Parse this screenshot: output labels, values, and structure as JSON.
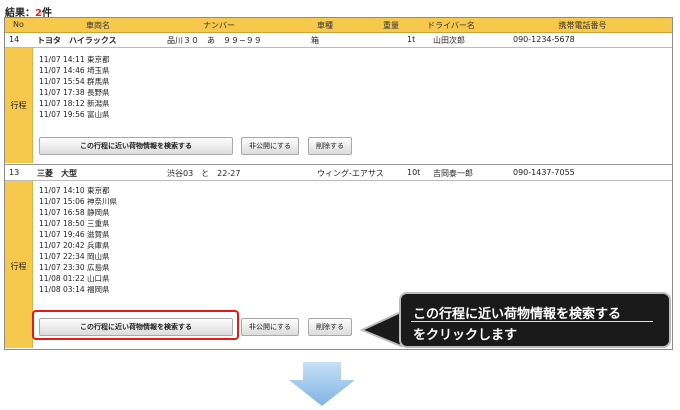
{
  "result": {
    "label": "結果：",
    "count": "2",
    "unit": "件"
  },
  "table": {
    "headers": [
      "No",
      "車両名",
      "ナンバー",
      "車種",
      "重量",
      "ドライバー名",
      "携帯電話番号"
    ],
    "trip_label": "行程"
  },
  "vehicles": [
    {
      "no": "14",
      "name": "トヨタ　ハイラックス",
      "plate": "品川３０　あ　９９−９９",
      "type": "箱",
      "weight": "1t",
      "driver": "山田次郎",
      "phone": "090-1234-5678",
      "stops": [
        "11/07 14:11 東京都",
        "11/07 14:46 埼玉県",
        "11/07 15:54 群馬県",
        "11/07 17:38 長野県",
        "11/07 18:12 新潟県",
        "11/07 19:56 富山県"
      ]
    },
    {
      "no": "13",
      "name": "三菱　大型",
      "plate": "渋谷03　と　22-27",
      "type": "ウィング-エアサス",
      "weight": "10t",
      "driver": "吉岡泰一郎",
      "phone": "090-1437-7055",
      "stops": [
        "11/07 14:10 東京都",
        "11/07 15:06 神奈川県",
        "11/07 16:58 静岡県",
        "11/07 18:50 三重県",
        "11/07 19:46 滋賀県",
        "11/07 20:42 兵庫県",
        "11/07 22:34 岡山県",
        "11/07 23:30 広島県",
        "11/08 01:22 山口県",
        "11/08 03:14 福岡県"
      ]
    }
  ],
  "buttons": {
    "search": "この行程に近い荷物情報を検索する",
    "hide": "非公開にする",
    "delete": "削除する"
  },
  "callout": {
    "line1": "この行程に近い荷物情報を検索する",
    "line2": "をクリックします"
  },
  "colors": {
    "header": "#f6c84c",
    "highlight": "#e31b12",
    "callout_bg": "#1a1a1a",
    "arrow": "#8fbde6"
  }
}
